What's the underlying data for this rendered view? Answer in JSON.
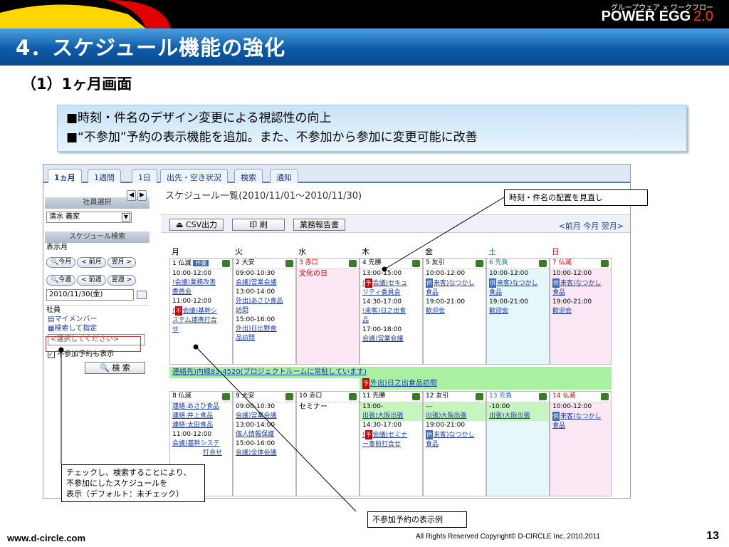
{
  "header": {
    "brand_sub": "グループウェア × ワークフロー",
    "brand_name": "POWER EGG",
    "brand_version": "2.0",
    "slide_title": "4．スケジュール機能の強化",
    "section_heading": "（1）1ヶ月画面",
    "accent_color": "#0e5aa8"
  },
  "bullets": [
    "■時刻・件名のデザイン変更による視認性の向上",
    "■“不参加”予約の表示機能を追加。また、不参加から参加に変更可能に改善"
  ],
  "app": {
    "tabs": [
      "1ヵ月",
      "1週間",
      "1日",
      "出先・空き状況",
      "検索",
      "通知"
    ],
    "active_tab": "1ヵ月",
    "left_panel": {
      "employee_select_header": "社員選択",
      "employee_value": "清水 義家",
      "search_header": "スケジュール検索",
      "display_month_label": "表示月",
      "btn_this_month": "今月",
      "btn_prev_month": "前月",
      "btn_next_month": "翌月",
      "btn_this_week": "今週",
      "btn_prev_week": "前週",
      "btn_next_week": "翌週",
      "date_value": "2010/11/30(金)",
      "employee_label": "社員",
      "my_members": "マイメンバー",
      "search_specify": "検索して指定",
      "select_placeholder": "<選択してください>",
      "absent_checkbox_label": "不参加予約も表示",
      "search_button": "検 索"
    },
    "schedule_title": "スケジュール一覧(2010/11/01〜2010/11/30)",
    "toolbar": {
      "csv_button": "CSV出力",
      "print_button": "印 刷",
      "report_button": "業務報告書",
      "nav_links": "<前月 今月 翌月>"
    },
    "weekday_headers": [
      "月",
      "火",
      "水",
      "木",
      "金",
      "土",
      "日"
    ],
    "week1": {
      "days": [
        "1 仏滅",
        "2 大安",
        "3 赤口",
        "4 先勝",
        "5 友引",
        "6 先負",
        "7 仏滅"
      ],
      "work_badge": "作業",
      "mon": [
        "10:00-12:00",
        "会議)業務改善",
        "委員会",
        "11:00-12:00",
        "会議)基幹シ",
        "ステム連携打合",
        "せ"
      ],
      "tue": [
        "09:00-10:30",
        "会議)営業会議",
        "13:00-14:00",
        "外出)あさひ食品",
        "訪問",
        "15:00-16:00",
        "外出)日比野食",
        "品訪問"
      ],
      "wed": [
        "文化の日"
      ],
      "thu": [
        "13:00-15:00",
        "会議)セキュ",
        "リティ委員会",
        "14:30-17:00",
        "来客)日之出食",
        "品",
        "17:00-18:00",
        "会議)営業会議"
      ],
      "fri": [
        "10:00-12:00",
        "来客)なつかし",
        "食品",
        "19:00-21:00",
        "歓迎会"
      ],
      "sat": [
        "10:00-12:00",
        "来客)なつかし",
        "食品",
        "19:00-21:00",
        "歓迎会"
      ],
      "sun": [
        "10:00-12:00",
        "来客)なつかし",
        "食品",
        "19:00-21:00",
        "歓迎会"
      ],
      "allday_1": "連絡先)内線83-4520(プロジェクトルームに常駐しています)",
      "allday_2": "外出)日之出食品訪問"
    },
    "week2": {
      "days": [
        "8 仏滅",
        "9 大安",
        "10 赤口",
        "11 先勝",
        "12 友引",
        "13 先負",
        "14 仏滅"
      ],
      "mon": [
        "連絡:あさひ食品",
        "連絡:井上食品",
        "連絡:太田食品",
        "11:00-12:00",
        "会議)基幹システ",
        "打合せ"
      ],
      "tue": [
        "09:00-10:30",
        "会議)営業会議",
        "13:00-14:00",
        "個人情報保護",
        "15:00-16:00",
        "会議)全体会議"
      ],
      "wed": [
        "セミナー"
      ],
      "thu": [
        "13:00-",
        "出張)大阪出張",
        "14:30-17:00",
        "会議)セミナ",
        "ー事前打合せ"
      ],
      "fri": [
        "---",
        "出張)大阪出張",
        "19:00-21:00",
        "来客)なつかし",
        "食品"
      ],
      "sat": [
        "-10:00",
        "出張)大阪出張"
      ],
      "sun": [
        "10:00-12:00",
        "来客)なつかし",
        "食品"
      ]
    }
  },
  "callouts": {
    "top_right": "時刻・件名の配置を見直し",
    "bottom_left": [
      "チェックし、検索することにより、",
      "不参加にしたスケジュールを",
      "表示（デフォルト：未チェック）"
    ],
    "bottom_center": "不参加予約の表示例"
  },
  "footer": {
    "url": "www.d-circle.com",
    "copyright": "All Rights Reserved Copyright© D-CIRCLE Inc, 2010,2011",
    "page_number": "13"
  }
}
